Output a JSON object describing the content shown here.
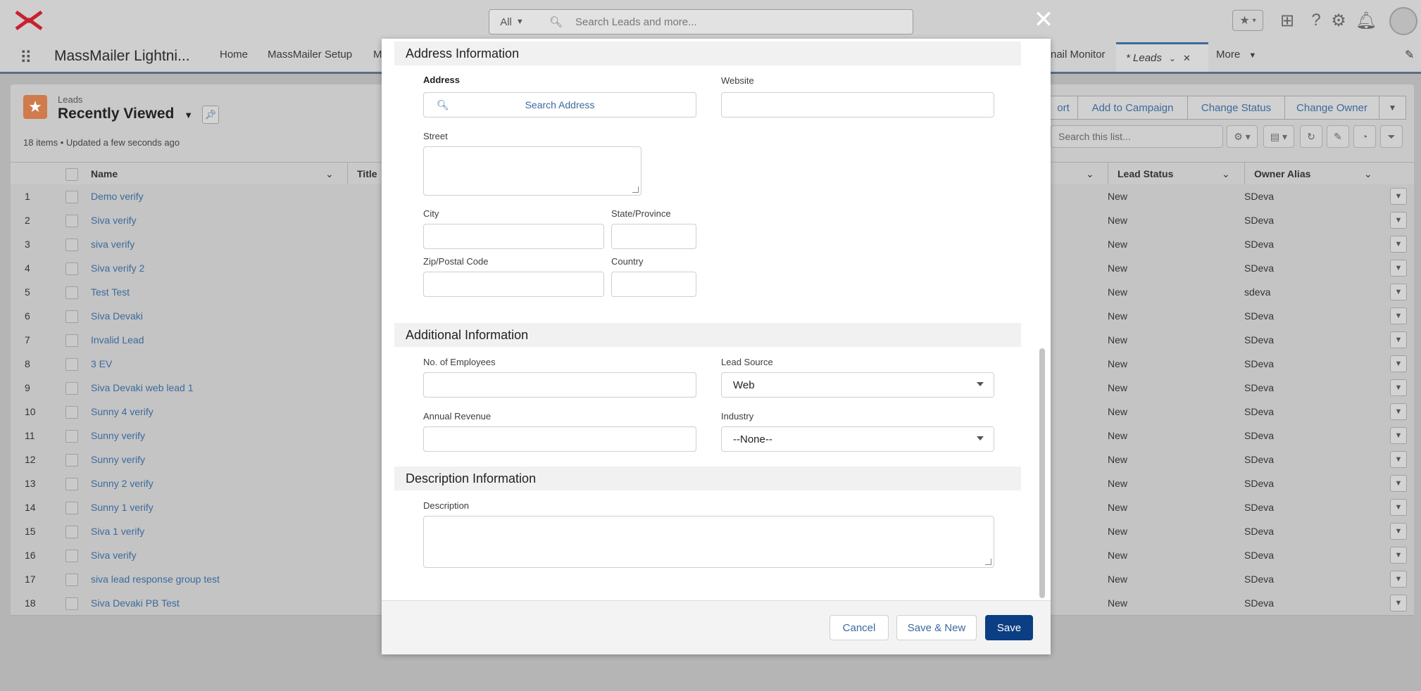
{
  "header": {
    "search_scope": "All",
    "search_placeholder": "Search Leads and more..."
  },
  "nav": {
    "app_name": "MassMailer Lightni...",
    "items": [
      "Home",
      "MassMailer Setup",
      "M"
    ],
    "email_monitor_partial": "nail Monitor",
    "leads_tab": "* Leads",
    "more": "More"
  },
  "list": {
    "object_label": "Leads",
    "view_name": "Recently Viewed",
    "status": "18 items • Updated a few seconds ago",
    "actions": [
      "ort",
      "Add to Campaign",
      "Change Status",
      "Change Owner"
    ],
    "search_placeholder": "Search this list...",
    "columns": {
      "name": "Name",
      "title": "Title",
      "lead_status": "Lead Status",
      "owner_alias": "Owner Alias"
    },
    "rows": [
      {
        "num": "1",
        "name": "Demo verify",
        "status": "New",
        "owner": "SDeva"
      },
      {
        "num": "2",
        "name": "Siva verify",
        "status": "New",
        "owner": "SDeva"
      },
      {
        "num": "3",
        "name": "siva verify",
        "status": "New",
        "owner": "SDeva"
      },
      {
        "num": "4",
        "name": "Siva verify 2",
        "status": "New",
        "owner": "SDeva"
      },
      {
        "num": "5",
        "name": "Test Test",
        "status": "New",
        "owner": "sdeva"
      },
      {
        "num": "6",
        "name": "Siva Devaki",
        "status": "New",
        "owner": "SDeva"
      },
      {
        "num": "7",
        "name": "Invalid Lead",
        "status": "New",
        "owner": "SDeva"
      },
      {
        "num": "8",
        "name": "3 EV",
        "status": "New",
        "owner": "SDeva"
      },
      {
        "num": "9",
        "name": "Siva Devaki web lead 1",
        "status": "New",
        "owner": "SDeva"
      },
      {
        "num": "10",
        "name": "Sunny 4 verify",
        "status": "New",
        "owner": "SDeva"
      },
      {
        "num": "11",
        "name": "Sunny verify",
        "status": "New",
        "owner": "SDeva"
      },
      {
        "num": "12",
        "name": "Sunny verify",
        "status": "New",
        "owner": "SDeva"
      },
      {
        "num": "13",
        "name": "Sunny 2 verify",
        "status": "New",
        "owner": "SDeva"
      },
      {
        "num": "14",
        "name": "Sunny 1 verify",
        "status": "New",
        "owner": "SDeva"
      },
      {
        "num": "15",
        "name": "Siva 1 verify",
        "status": "New",
        "owner": "SDeva"
      },
      {
        "num": "16",
        "name": "Siva verify",
        "status": "New",
        "owner": "SDeva"
      },
      {
        "num": "17",
        "name": "siva lead response group test",
        "status": "New",
        "owner": "SDeva"
      },
      {
        "num": "18",
        "name": "Siva Devaki PB Test",
        "status": "New",
        "owner": "SDeva"
      }
    ]
  },
  "modal": {
    "address_section": "Address Information",
    "address_label": "Address",
    "search_address": "Search Address",
    "website_label": "Website",
    "street_label": "Street",
    "city_label": "City",
    "state_label": "State/Province",
    "zip_label": "Zip/Postal Code",
    "country_label": "Country",
    "additional_section": "Additional Information",
    "employees_label": "No. of Employees",
    "lead_source_label": "Lead Source",
    "lead_source_value": "Web",
    "revenue_label": "Annual Revenue",
    "industry_label": "Industry",
    "industry_value": "--None--",
    "description_section": "Description Information",
    "description_label": "Description",
    "cancel": "Cancel",
    "save_new": "Save & New",
    "save": "Save"
  },
  "colors": {
    "save_button": "#0b3e82",
    "link": "#3c6a9c",
    "leads_icon": "#d07b4b",
    "logo": "#c8202f"
  },
  "icons": [
    "x-logo-icon",
    "search-icon",
    "star-icon",
    "plus-icon",
    "help-icon",
    "gear-icon",
    "bell-icon",
    "avatar",
    "close-icon",
    "pin-icon",
    "chevron-down-icon",
    "refresh-icon",
    "edit-icon"
  ]
}
